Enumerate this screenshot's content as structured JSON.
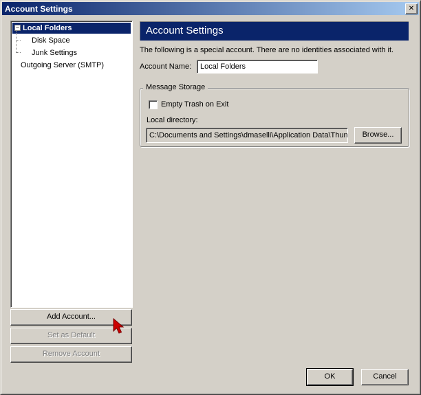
{
  "window": {
    "title": "Account Settings",
    "close_glyph": "✕"
  },
  "tree": {
    "items": [
      {
        "label": "Local Folders",
        "toggle": "−",
        "selected": true
      },
      {
        "label": "Disk Space"
      },
      {
        "label": "Junk Settings"
      },
      {
        "label": "Outgoing Server (SMTP)"
      }
    ]
  },
  "left_buttons": {
    "add_account": "Add Account...",
    "set_default": "Set as Default",
    "remove_account": "Remove Account"
  },
  "panel": {
    "header": "Account Settings",
    "description": "The following is a special account. There are no identities associated with it.",
    "account_name_label": "Account Name:",
    "account_name_value": "Local Folders",
    "storage_legend": "Message Storage",
    "empty_trash_label": "Empty Trash on Exit",
    "empty_trash_checked": false,
    "local_dir_label": "Local directory:",
    "local_dir_value": "C:\\Documents and Settings\\dmaselli\\Application Data\\Thunderbird",
    "browse_label": "Browse..."
  },
  "footer": {
    "ok": "OK",
    "cancel": "Cancel"
  },
  "icons": {
    "cursor": "arrow-cursor-icon"
  },
  "colors": {
    "title_start": "#0a246a",
    "title_end": "#a6caf0",
    "selection": "#0a246a",
    "face": "#d4d0c8",
    "cursor": "#cc0000"
  }
}
